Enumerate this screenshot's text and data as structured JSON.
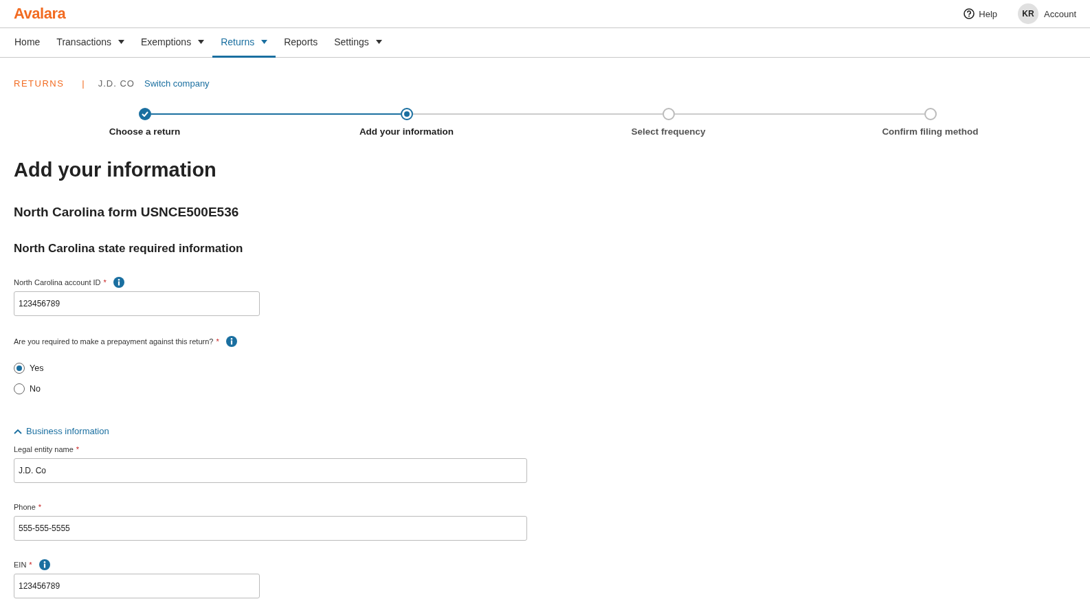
{
  "header": {
    "logo": "Avalara",
    "help": "Help",
    "avatar": "KR",
    "account": "Account"
  },
  "nav": [
    {
      "label": "Home",
      "dropdown": false,
      "selected": false
    },
    {
      "label": "Transactions",
      "dropdown": true,
      "selected": false
    },
    {
      "label": "Exemptions",
      "dropdown": true,
      "selected": false
    },
    {
      "label": "Returns",
      "dropdown": true,
      "selected": true
    },
    {
      "label": "Reports",
      "dropdown": false,
      "selected": false
    },
    {
      "label": "Settings",
      "dropdown": true,
      "selected": false
    }
  ],
  "breadcrumb": {
    "section": "RETURNS",
    "separator": "|",
    "company": "J.D. CO",
    "link": "Switch company"
  },
  "steps": [
    {
      "label": "Choose a return",
      "kind": "done"
    },
    {
      "label": "Add your information",
      "kind": "current"
    },
    {
      "label": "Select frequency",
      "kind": "todo"
    },
    {
      "label": "Confirm filing method",
      "kind": "todo"
    }
  ],
  "title": "Add your information",
  "form_title": "North Carolina form USNCE500E536",
  "section_title": "North Carolina state required information",
  "state_fields": [
    {
      "label": "North Carolina account ID",
      "required": "*",
      "info": true,
      "value": "123456789",
      "kind": "short"
    }
  ],
  "question": {
    "label": "Are you required to make a prepayment against this return?",
    "required": "*",
    "info": true,
    "options": [
      {
        "label": "Yes",
        "selected": true
      },
      {
        "label": "No",
        "selected": false
      }
    ]
  },
  "business": {
    "label": "Business information",
    "expanded": true,
    "fields": [
      {
        "label": "Legal entity name",
        "required": "*",
        "info": false,
        "value": "J.D. Co",
        "kind": "wide"
      },
      {
        "label": "Phone",
        "required": "*",
        "info": false,
        "value": "555-555-5555",
        "kind": "wide"
      },
      {
        "label": "EIN",
        "required": "*",
        "info": true,
        "value": "123456789",
        "kind": "short"
      }
    ]
  }
}
